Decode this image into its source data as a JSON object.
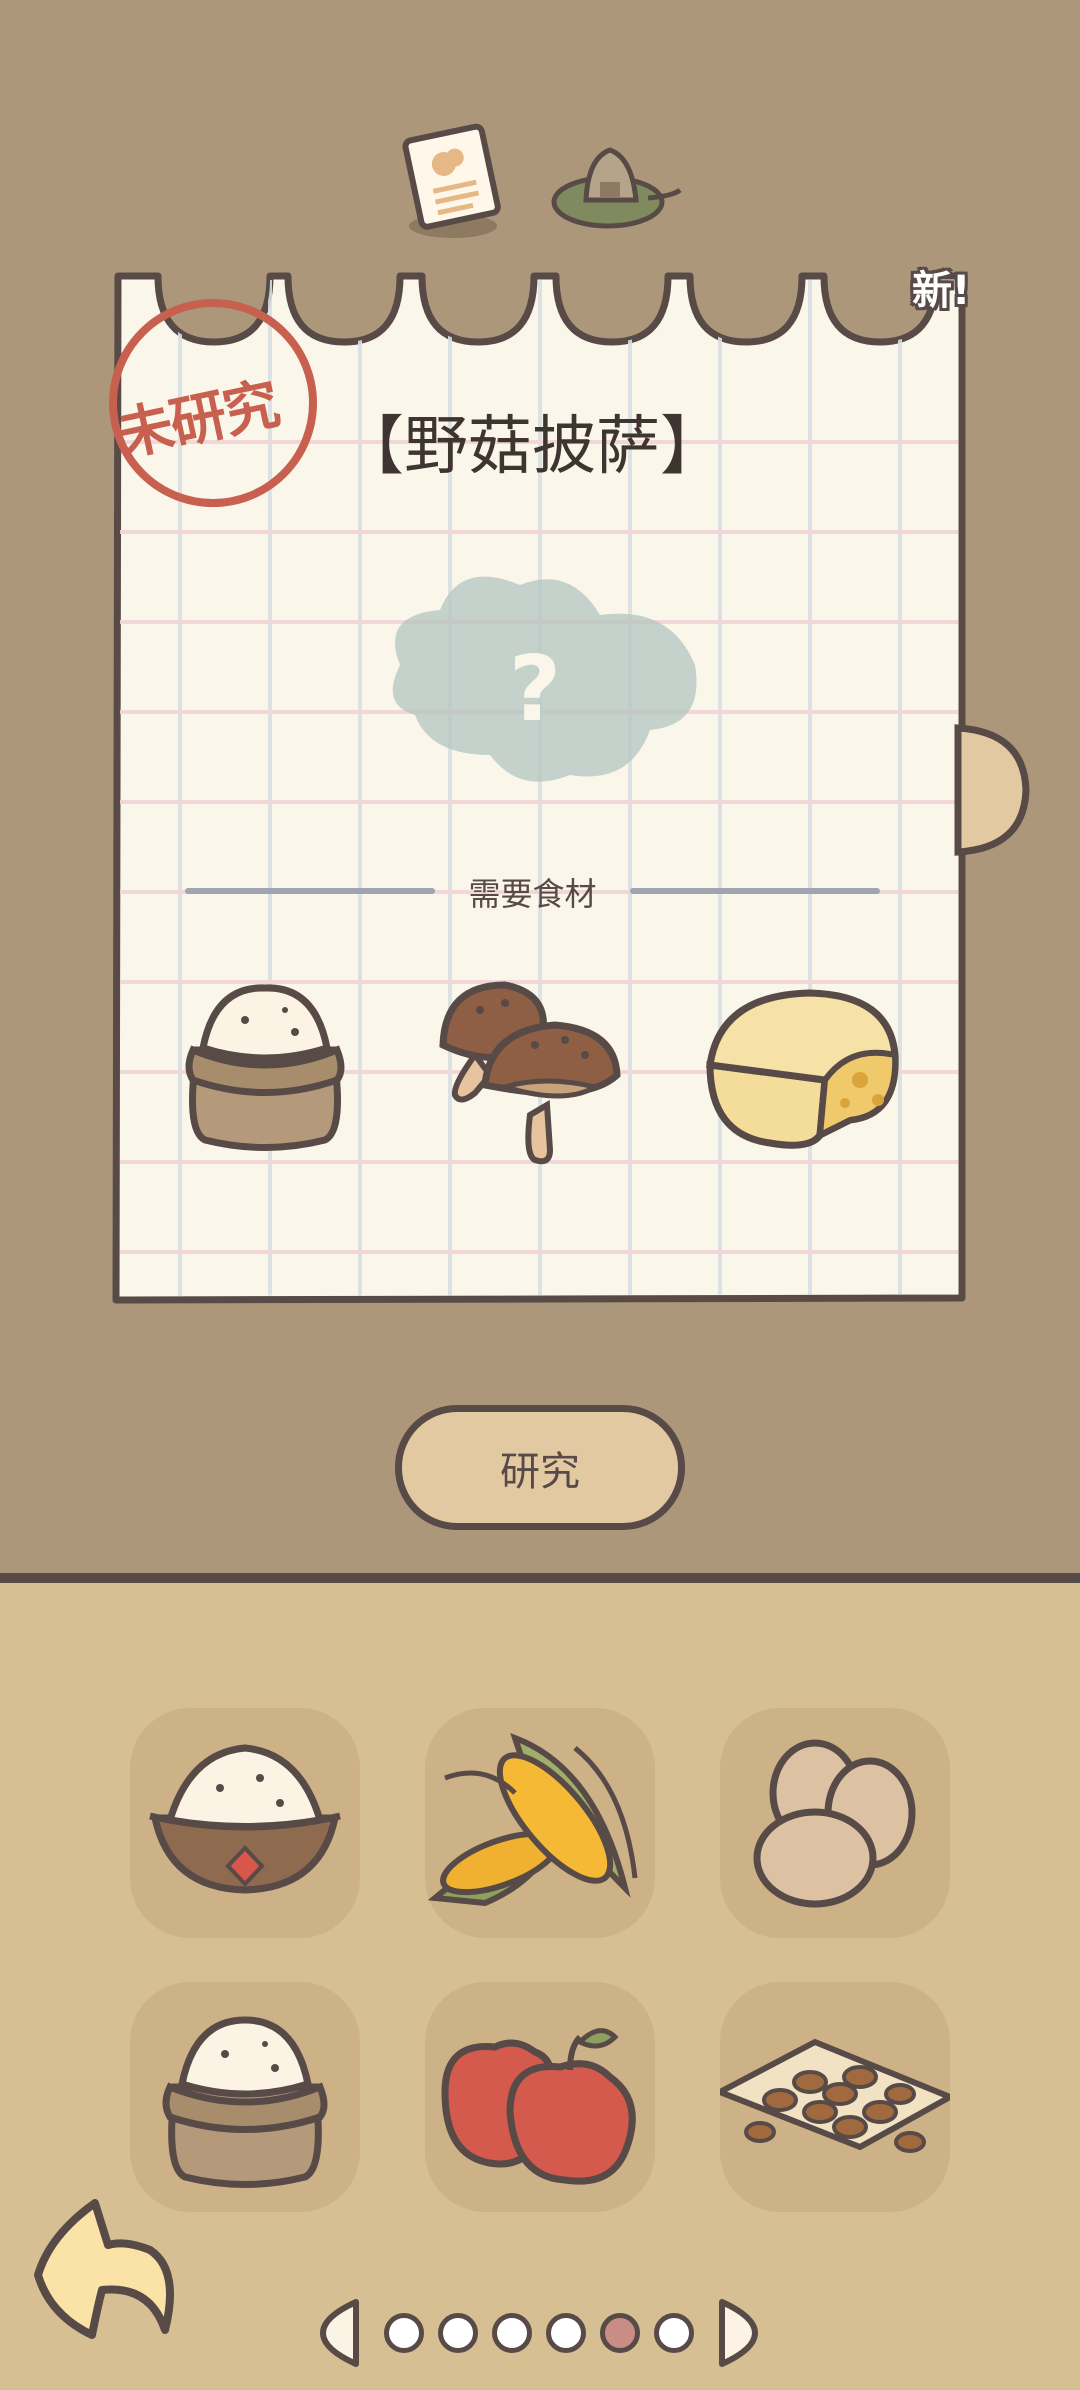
{
  "tabs": [
    {
      "name": "recipe-card-tab",
      "icon": "recipe-card-icon"
    },
    {
      "name": "rice-ball-tab",
      "icon": "rice-ball-icon"
    }
  ],
  "recipe": {
    "title": "【野菇披萨】",
    "status_stamp": "未研究",
    "new_badge": "新!",
    "ingredients_label": "需要食材",
    "ingredients": [
      "flour-sack-icon",
      "mushroom-icon",
      "cheese-icon"
    ]
  },
  "research_button": "研究",
  "inventory": {
    "items": [
      "flour-bowl-icon",
      "corn-icon",
      "eggs-icon",
      "flour-sack-icon",
      "apples-icon",
      "nuts-icon"
    ]
  },
  "pager": {
    "pages": 6,
    "active_page": 5
  },
  "colors": {
    "background": "#ad977a",
    "inventory_background": "#d6bf93",
    "outline": "#574a47",
    "stamp": "#c8604f"
  }
}
